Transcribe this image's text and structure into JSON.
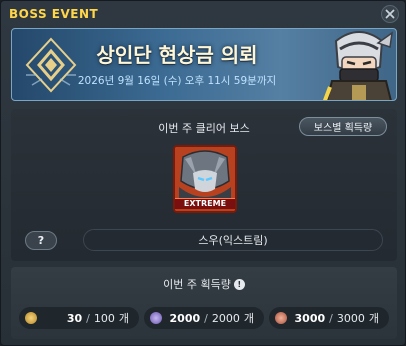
{
  "window": {
    "title": "BOSS EVENT"
  },
  "banner": {
    "title": "상인단 현상금 의뢰",
    "subtitle": "2026년 9월 16일 (수) 오후 11시 59분까지"
  },
  "boss_section": {
    "label": "이번 주 클리어 보스",
    "reward_button": "보스별 획득량",
    "boss_badge": "EXTREME",
    "help_button": "?",
    "boss_name": "스우(익스트림)"
  },
  "gain_section": {
    "label": "이번 주 획득량",
    "counters": [
      {
        "current": "30",
        "max": "100",
        "unit": "개",
        "icon": "gold-coin-icon",
        "color": "#e6b84a"
      },
      {
        "current": "2000",
        "max": "2000",
        "unit": "개",
        "icon": "purple-coin-icon",
        "color": "#9a86d8"
      },
      {
        "current": "3000",
        "max": "3000",
        "unit": "개",
        "icon": "red-coin-icon",
        "color": "#d8846a"
      }
    ]
  },
  "colors": {
    "title": "#ffd64a",
    "banner_title": "#fff6d6",
    "banner_sub": "#bfe2ff",
    "boss_card": "#b23a1f"
  }
}
